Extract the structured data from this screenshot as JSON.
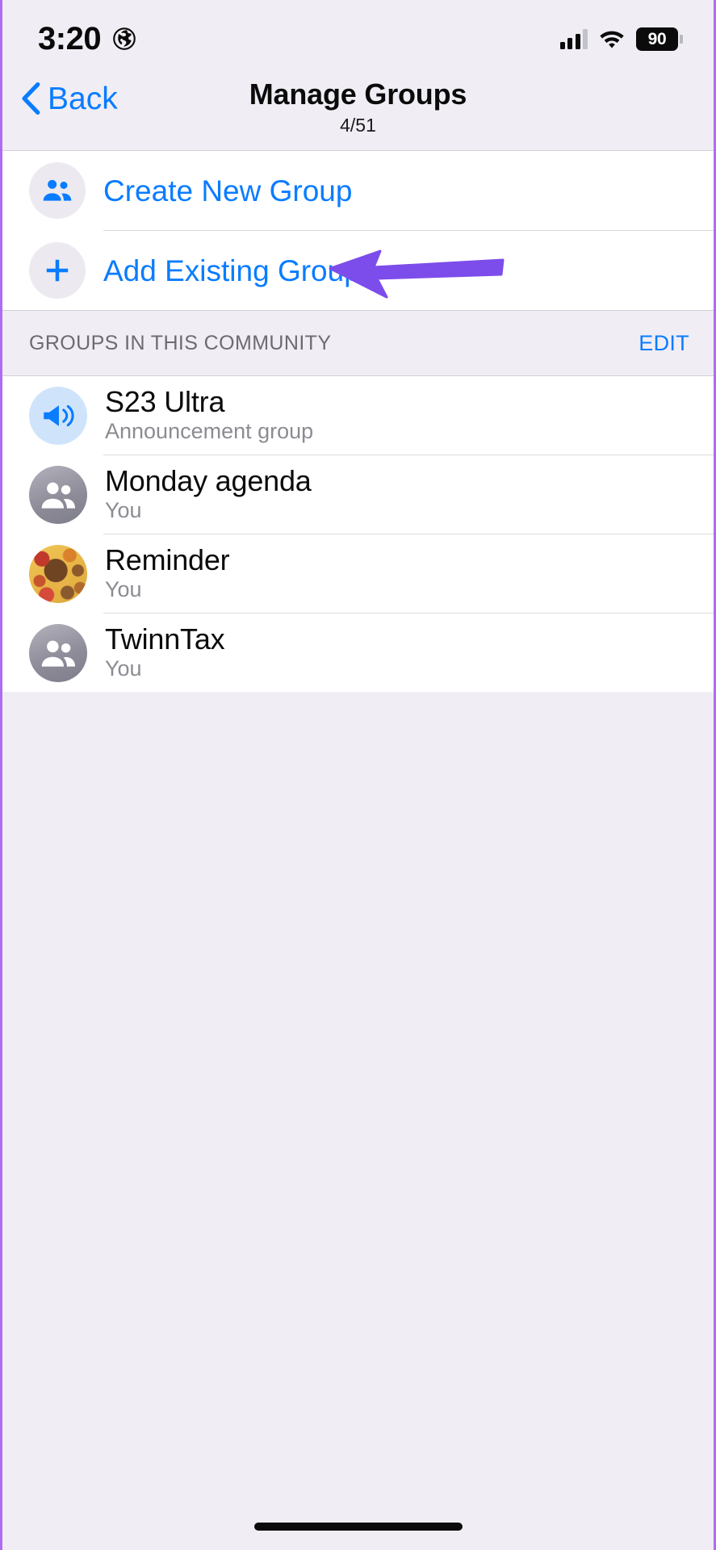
{
  "status_bar": {
    "time": "3:20",
    "globe_icon": "globe-icon",
    "signal_icon": "cellular-signal-icon",
    "wifi_icon": "wifi-icon",
    "battery_level": "90"
  },
  "nav": {
    "back_label": "Back",
    "back_icon": "chevron-left-icon",
    "title": "Manage Groups",
    "subtitle": "4/51"
  },
  "actions": [
    {
      "label": "Create New Group",
      "icon": "people-icon"
    },
    {
      "label": "Add Existing Group",
      "icon": "plus-icon"
    }
  ],
  "section": {
    "title": "GROUPS IN THIS COMMUNITY",
    "edit_label": "EDIT"
  },
  "groups": [
    {
      "name": "S23 Ultra",
      "subtitle": "Announcement group",
      "avatar_type": "announcement",
      "avatar_icon": "megaphone-icon"
    },
    {
      "name": "Monday agenda",
      "subtitle": "You",
      "avatar_type": "people",
      "avatar_icon": "people-group-icon"
    },
    {
      "name": "Reminder",
      "subtitle": "You",
      "avatar_type": "photo",
      "avatar_icon": "group-photo"
    },
    {
      "name": "TwinnTax",
      "subtitle": "You",
      "avatar_type": "people",
      "avatar_icon": "people-group-icon"
    }
  ],
  "annotation": {
    "arrow_icon": "left-pointing-arrow",
    "color": "#7c4dea"
  },
  "colors": {
    "accent_blue": "#0a7cff",
    "background": "#f0eef4",
    "card": "#ffffff",
    "border_purple": "#b06cf0",
    "arrow_purple": "#7c4dea",
    "secondary_text": "#8d8b92"
  }
}
